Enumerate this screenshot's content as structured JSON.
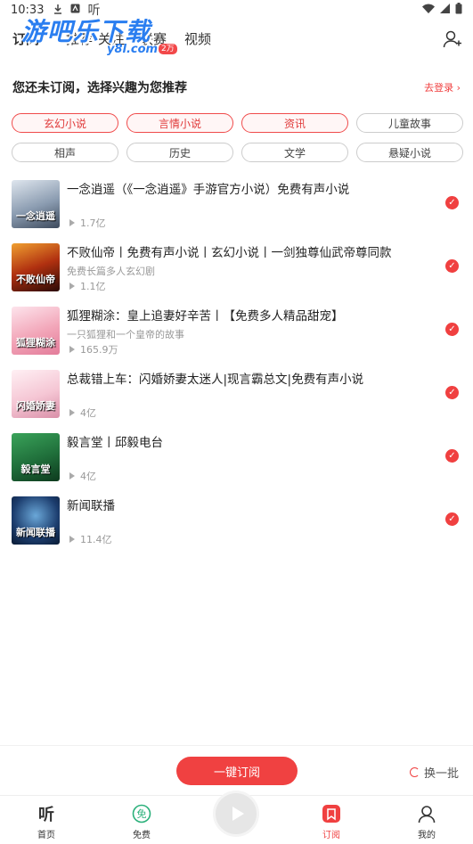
{
  "status_bar": {
    "time": "10:33",
    "icons": [
      "download-icon",
      "notification-icon",
      "ting-icon"
    ],
    "right_icons": [
      "wifi-icon",
      "signal-icon",
      "battery-icon"
    ]
  },
  "watermark": {
    "main": "游吧乐下载",
    "sub": "y8l.com"
  },
  "top_tabs": [
    {
      "label": "订阅",
      "active": true
    },
    {
      "label": "推荐"
    },
    {
      "label": "关注"
    },
    {
      "label": "联赛"
    },
    {
      "label": "视频"
    }
  ],
  "tab_badge": "2万",
  "header": {
    "prompt": "您还未订阅，选择兴趣为您推荐",
    "login_link": "去登录 ›"
  },
  "chips": [
    {
      "label": "玄幻小说",
      "selected": true
    },
    {
      "label": "言情小说",
      "selected": true
    },
    {
      "label": "资讯",
      "selected": true
    },
    {
      "label": "儿童故事",
      "selected": false
    },
    {
      "label": "相声",
      "selected": false
    },
    {
      "label": "历史",
      "selected": false
    },
    {
      "label": "文学",
      "selected": false
    },
    {
      "label": "悬疑小说",
      "selected": false
    }
  ],
  "items": [
    {
      "title": "一念逍遥（《一念逍遥》手游官方小说）免费有声小说",
      "desc": "",
      "plays": "1.7亿",
      "cover_text": "一念逍遥",
      "cover_color": "#8a9bb0"
    },
    {
      "title": "不败仙帝丨免费有声小说丨玄幻小说丨一剑独尊仙武帝尊同款",
      "desc": "免费长篇多人玄幻剧",
      "plays": "1.1亿",
      "cover_text": "不败仙帝",
      "cover_color": "#7a2010"
    },
    {
      "title": "狐狸糊涂：皇上追妻好辛苦丨【免费多人精品甜宠】",
      "desc": "一只狐狸和一个皇帝的故事",
      "plays": "165.9万",
      "cover_text": "狐狸糊涂",
      "cover_color": "#f2a5b8"
    },
    {
      "title": "总裁错上车：闪婚娇妻太迷人|现言霸总文|免费有声小说",
      "desc": "",
      "plays": "4亿",
      "cover_text": "闪婚娇妻",
      "cover_color": "#f5c6d4"
    },
    {
      "title": "毅言堂丨邱毅电台",
      "desc": "",
      "plays": "4亿",
      "cover_text": "毅言堂",
      "cover_color": "#1f6e3a"
    },
    {
      "title": "新闻联播",
      "desc": "",
      "plays": "11.4亿",
      "cover_text": "新闻联播",
      "cover_color": "#1c3d6e"
    }
  ],
  "actions": {
    "subscribe_all": "一键订阅",
    "refresh": "换一批"
  },
  "bottom_nav": [
    {
      "label": "首页",
      "icon": "ting-logo-icon"
    },
    {
      "label": "免费",
      "icon": "free-icon"
    },
    {
      "label": "订阅",
      "icon": "subscribe-icon",
      "active": true
    },
    {
      "label": "我的",
      "icon": "profile-icon"
    }
  ],
  "colors": {
    "accent": "#f04040",
    "free_green": "#2ab07a"
  }
}
